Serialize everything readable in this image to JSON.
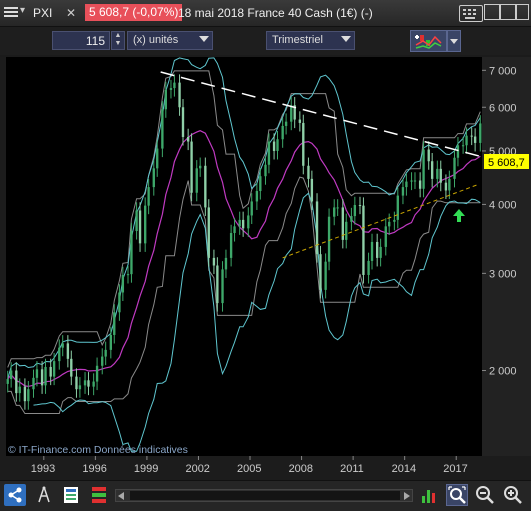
{
  "titlebar": {
    "symbol": "PXI",
    "close_glyph": "✕",
    "dropdown_glyph": "▾",
    "price_change": "5 608,7 (-0,07%)",
    "description": "18 mai 2018 France 40 Cash (1€) (-)",
    "icons": [
      "menu-icon",
      "keyboard-icon",
      "window-icon",
      "window-icon",
      "window-icon"
    ]
  },
  "toolbar": {
    "quantity": "115",
    "unit": "(x) unités",
    "period": "Trimestriel",
    "icons": [
      "indicators-icon",
      "chevron-down-icon",
      "order-arrows-icon"
    ]
  },
  "chart": {
    "watermark": "© IT-Finance.com  Données indicatives",
    "last_price_label": "5 608,7",
    "y_ticks": [
      "7 000",
      "6 000",
      "5 000",
      "4 000",
      "3 000",
      "2 000"
    ],
    "x_ticks": [
      "1993",
      "1996",
      "1999",
      "2002",
      "2005",
      "2008",
      "2011",
      "2014",
      "2017"
    ],
    "colors": {
      "background": "#000000",
      "axis_panel": "#222222",
      "candle_up": "#3ea86a",
      "candle_down": "#8fd0a8",
      "bollinger_outer": "#5fc6cf",
      "bollinger_mid": "#c03ac2",
      "price_channel": "#8a8a8a",
      "trendline": "#ffffff",
      "support_line": "#c8a400",
      "price_label_bg": "#ffff00",
      "signal_arrow": "#33dd55"
    },
    "icons": [
      "up-arrow-signal-icon"
    ]
  },
  "chart_data": {
    "type": "candlestick",
    "frequency": "quarterly",
    "xlim": [
      1990.8,
      2018.5
    ],
    "ylim": [
      1400,
      7400
    ],
    "y_scale": "log",
    "bars": [
      [
        1990.9,
        1930
      ],
      [
        1991.1,
        2000
      ],
      [
        1991.4,
        1820
      ],
      [
        1991.6,
        1870
      ],
      [
        1991.9,
        1760
      ],
      [
        1992.1,
        1850
      ],
      [
        1992.4,
        1940
      ],
      [
        1992.6,
        2010
      ],
      [
        1992.9,
        1880
      ],
      [
        1993.1,
        2030
      ],
      [
        1993.4,
        1950
      ],
      [
        1993.6,
        2080
      ],
      [
        1993.9,
        2200
      ],
      [
        1994.1,
        2240
      ],
      [
        1994.4,
        2100
      ],
      [
        1994.6,
        1950
      ],
      [
        1994.9,
        1850
      ],
      [
        1995.1,
        1880
      ],
      [
        1995.4,
        1920
      ],
      [
        1995.6,
        1870
      ],
      [
        1995.9,
        1910
      ],
      [
        1996.1,
        2040
      ],
      [
        1996.4,
        2120
      ],
      [
        1996.6,
        2180
      ],
      [
        1996.9,
        2320
      ],
      [
        1997.1,
        2550
      ],
      [
        1997.4,
        2770
      ],
      [
        1997.6,
        2980
      ],
      [
        1997.9,
        2990
      ],
      [
        1998.1,
        3580
      ],
      [
        1998.4,
        3900
      ],
      [
        1998.6,
        3400
      ],
      [
        1998.9,
        3980
      ],
      [
        1999.1,
        4300
      ],
      [
        1999.4,
        4650
      ],
      [
        1999.6,
        5050
      ],
      [
        1999.9,
        5950
      ],
      [
        2000.1,
        6450
      ],
      [
        2000.4,
        6500
      ],
      [
        2000.6,
        6650
      ],
      [
        2000.9,
        6000
      ],
      [
        2001.1,
        5300
      ],
      [
        2001.4,
        5200
      ],
      [
        2001.6,
        4200
      ],
      [
        2001.9,
        4650
      ],
      [
        2002.1,
        4700
      ],
      [
        2002.4,
        3950
      ],
      [
        2002.6,
        3200
      ],
      [
        2002.9,
        3100
      ],
      [
        2003.1,
        2650
      ],
      [
        2003.4,
        3050
      ],
      [
        2003.6,
        3200
      ],
      [
        2003.9,
        3550
      ],
      [
        2004.1,
        3650
      ],
      [
        2004.4,
        3750
      ],
      [
        2004.6,
        3620
      ],
      [
        2004.9,
        3820
      ],
      [
        2005.1,
        4050
      ],
      [
        2005.4,
        4230
      ],
      [
        2005.6,
        4500
      ],
      [
        2005.9,
        4720
      ],
      [
        2006.1,
        5200
      ],
      [
        2006.4,
        5000
      ],
      [
        2006.6,
        5250
      ],
      [
        2006.9,
        5550
      ],
      [
        2007.1,
        5650
      ],
      [
        2007.4,
        6050
      ],
      [
        2007.6,
        5700
      ],
      [
        2007.9,
        5620
      ],
      [
        2008.1,
        4700
      ],
      [
        2008.4,
        4450
      ],
      [
        2008.6,
        4050
      ],
      [
        2008.9,
        3250
      ],
      [
        2009.1,
        2800
      ],
      [
        2009.4,
        3150
      ],
      [
        2009.6,
        3800
      ],
      [
        2009.9,
        3950
      ],
      [
        2010.1,
        3950
      ],
      [
        2010.4,
        3450
      ],
      [
        2010.6,
        3720
      ],
      [
        2010.9,
        3810
      ],
      [
        2011.1,
        3990
      ],
      [
        2011.4,
        3980
      ],
      [
        2011.6,
        2980
      ],
      [
        2011.9,
        3160
      ],
      [
        2012.1,
        3420
      ],
      [
        2012.4,
        3200
      ],
      [
        2012.6,
        3350
      ],
      [
        2012.9,
        3650
      ],
      [
        2013.1,
        3720
      ],
      [
        2013.4,
        3750
      ],
      [
        2013.6,
        4150
      ],
      [
        2013.9,
        4300
      ],
      [
        2014.1,
        4400
      ],
      [
        2014.4,
        4420
      ],
      [
        2014.6,
        4420
      ],
      [
        2014.9,
        4270
      ],
      [
        2015.1,
        5030
      ],
      [
        2015.4,
        4790
      ],
      [
        2015.6,
        4450
      ],
      [
        2015.9,
        4640
      ],
      [
        2016.1,
        4380
      ],
      [
        2016.4,
        4240
      ],
      [
        2016.6,
        4450
      ],
      [
        2016.9,
        4860
      ],
      [
        2017.1,
        5120
      ],
      [
        2017.4,
        5120
      ],
      [
        2017.6,
        5330
      ],
      [
        2017.9,
        5310
      ],
      [
        2018.1,
        5170
      ],
      [
        2018.4,
        5608.7
      ]
    ],
    "series": [],
    "trendline": [
      [
        1999.8,
        6950
      ],
      [
        2018.5,
        4880
      ]
    ],
    "support_line": [
      [
        2006.9,
        3200
      ],
      [
        2018.3,
        4350
      ]
    ]
  }
}
